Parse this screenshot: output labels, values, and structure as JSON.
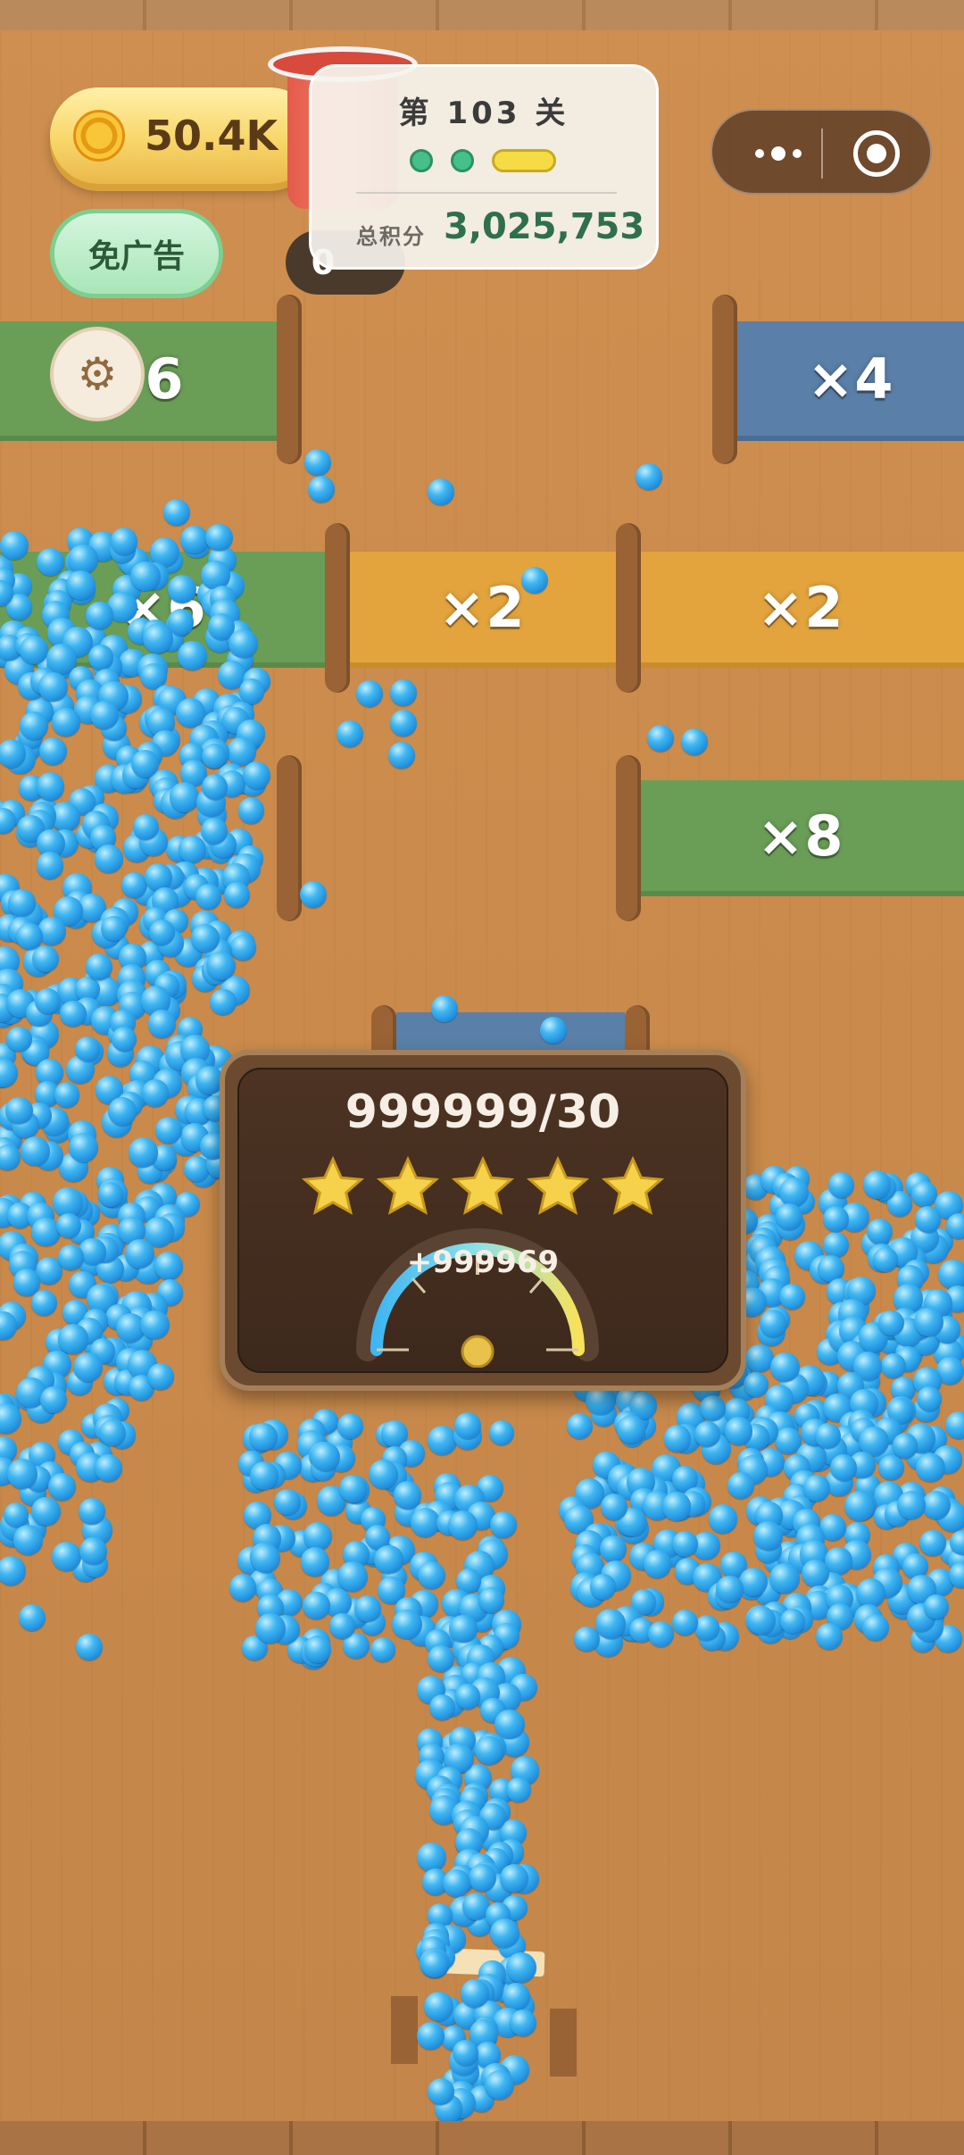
{
  "hud": {
    "coins": "50.4K",
    "coin_arrow": "›",
    "no_ads_label": "免广告",
    "counter": "0",
    "level_title": "第 103 关",
    "score_label": "总积分",
    "score_value": "3,025,753"
  },
  "zones": [
    {
      "label": "×6"
    },
    {
      "label": "×4"
    },
    {
      "label": "×6"
    },
    {
      "label": "×2"
    },
    {
      "label": "×2"
    },
    {
      "label": "×8"
    }
  ],
  "result": {
    "count": "999999/30",
    "stars": 5,
    "gain": "+999969"
  },
  "colors": {
    "ball": "#2b9ae6",
    "green_zone": "#6a9e57",
    "orange_zone": "#e3a43d",
    "blue_zone": "#5a7fa8"
  },
  "icons": {
    "coin": "coin-icon",
    "settings": "gear-icon",
    "more": "more-icon",
    "close": "target-icon",
    "star": "star-icon"
  }
}
